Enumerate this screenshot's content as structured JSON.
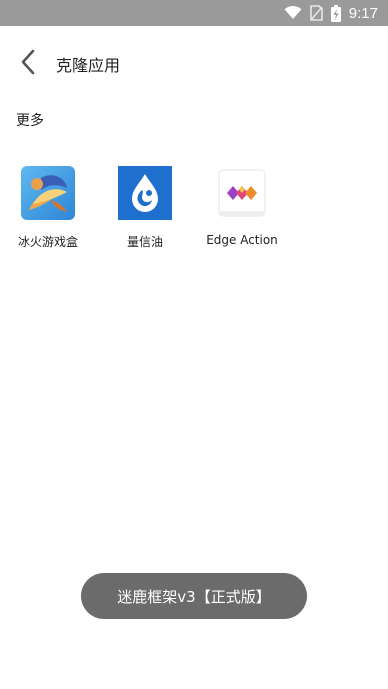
{
  "status_bar": {
    "time": "9:17",
    "icons": [
      "wifi-icon",
      "no-sim-icon",
      "battery-charging-icon"
    ]
  },
  "app_bar": {
    "title": "克隆应用",
    "back_icon": "chevron-left-icon"
  },
  "section": {
    "title": "更多"
  },
  "apps": [
    {
      "label": "冰火游戏盒",
      "icon": "dragon-game-box-icon"
    },
    {
      "label": "量信油",
      "icon": "blue-droplet-app-icon"
    },
    {
      "label": "Edge Action",
      "icon": "edge-action-diamonds-icon"
    }
  ],
  "toast": {
    "text": "迷鹿框架v3【正式版】"
  },
  "colors": {
    "status_bar": "#9a9a9a",
    "toast_bg": "#6b6b6b",
    "app2_bg": "#1f6fcf"
  }
}
